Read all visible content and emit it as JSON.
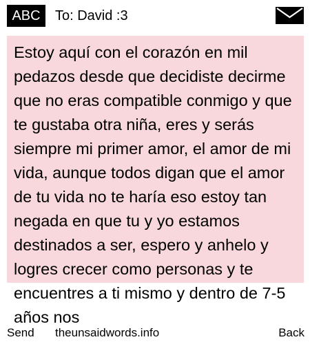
{
  "header": {
    "input_mode": "ABC",
    "recipient": "To: David :3",
    "envelope_icon": "envelope-icon"
  },
  "message": {
    "body": "Estoy aquí con el corazón en mil pedazos desde que decidiste decirme que no eras compatible conmigo y que te gustaba otra niña, eres y serás siempre mi primer amor, el amor de mi vida, aunque todos digan que el amor de tu vida no te haría eso  estoy tan negada en que tu y yo estamos destinados a ser, espero y anhelo y logres crecer como personas y te encuentres a ti mismo y dentro de 7-5 años nos"
  },
  "colors": {
    "message_background": "#f8d8dc",
    "badge_background": "#000000"
  },
  "softkeys": {
    "left": "Send",
    "center": "theunsaidwords.info",
    "right": "Back"
  }
}
